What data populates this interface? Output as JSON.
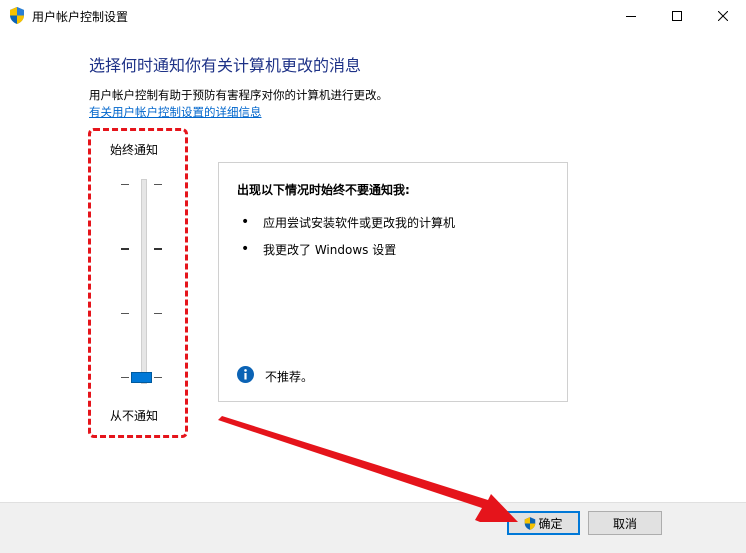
{
  "window": {
    "title": "用户帐户控制设置",
    "controls": {
      "minimize": "minimize",
      "maximize": "maximize",
      "close": "close"
    }
  },
  "main": {
    "heading": "选择何时通知你有关计算机更改的消息",
    "description": "用户帐户控制有助于预防有害程序对你的计算机进行更改。",
    "link": "有关用户帐户控制设置的详细信息"
  },
  "slider": {
    "top_label": "始终通知",
    "bottom_label": "从不通知",
    "levels": 4,
    "selected_level": 1
  },
  "panel": {
    "title": "出现以下情况时始终不要通知我:",
    "bullet_char": "•",
    "bullets": [
      "应用尝试安装软件或更改我的计算机",
      "我更改了 Windows 设置"
    ],
    "note": "不推荐。"
  },
  "buttons": {
    "ok": "确定",
    "cancel": "取消"
  },
  "colors": {
    "heading": "#1e3287",
    "link": "#0066cc",
    "accent": "#0078d7",
    "annotation": "#e5141b"
  },
  "icons": {
    "title": "uac-shield-icon",
    "info": "info-icon",
    "ok": "uac-shield-icon"
  }
}
